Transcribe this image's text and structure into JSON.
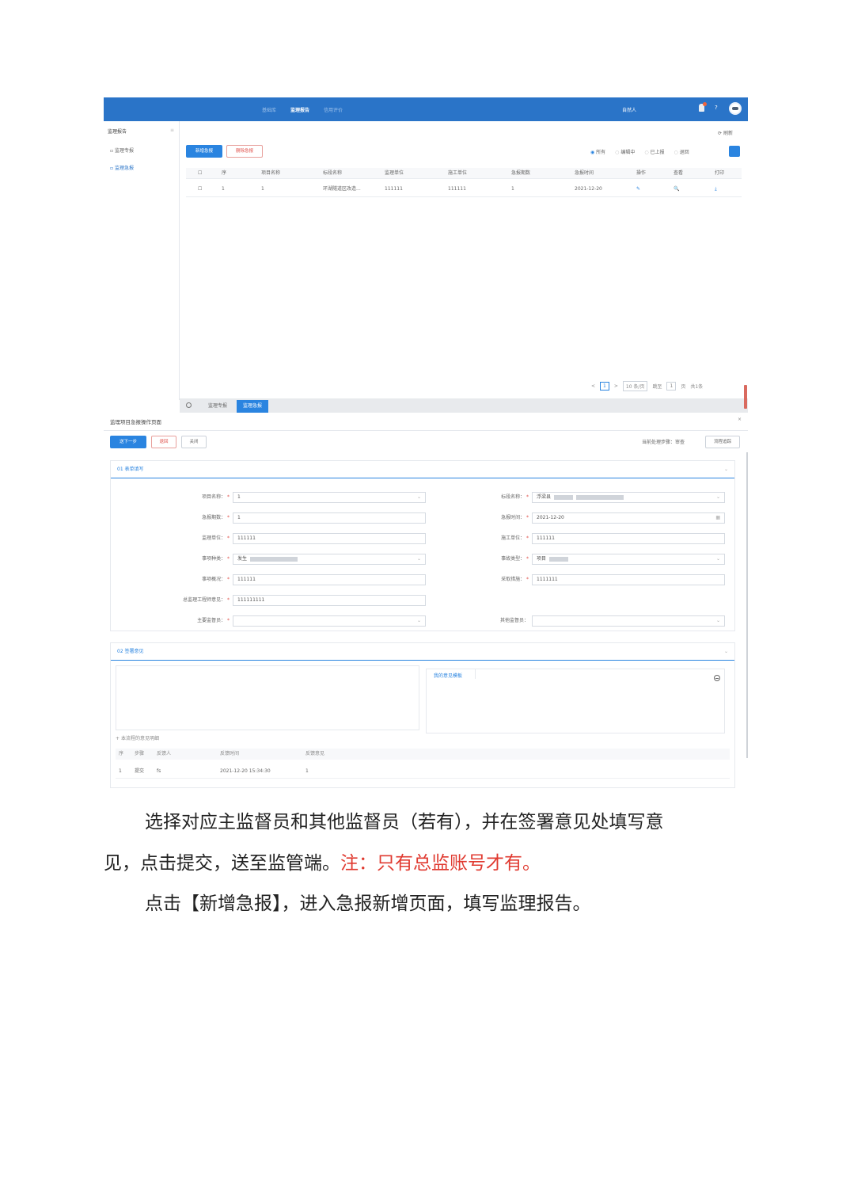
{
  "topbar": {
    "nav": [
      "基础库",
      "监理报告",
      "信用评价"
    ],
    "active_nav": "监理报告",
    "user": "自然人",
    "help": "?"
  },
  "sidebar": {
    "title": "监理报告",
    "collapse": "≡",
    "items": [
      "监理专报",
      "监理急报"
    ],
    "active_item": "监理急报"
  },
  "list": {
    "refresh": "刷新",
    "btn_add": "新增急报",
    "btn_delete": "删除急报",
    "filters": [
      "所有",
      "编辑中",
      "已上报",
      "退回"
    ],
    "filter_active": "所有",
    "columns": [
      "",
      "序",
      "项目名称",
      "标段名称",
      "监理单位",
      "施工单位",
      "急报期数",
      "急报时间",
      "操作",
      "查看",
      "打印"
    ],
    "rows": [
      [
        "",
        "1",
        "1",
        "环湖隧道区改造...",
        "111111",
        "111111",
        "1",
        "2021-12-20",
        "✎",
        "🔍",
        "⤓"
      ]
    ],
    "pager": {
      "prev": "<",
      "page": "1",
      "next": ">",
      "size": "10 条/页",
      "goto": "跳至",
      "goto_value": "1",
      "page_unit": "页",
      "total": "共1条"
    }
  },
  "tabbar": {
    "tabs": [
      "监理专报",
      "监理急报"
    ],
    "active_tab": "监理急报"
  },
  "modal": {
    "title": "监理项目急报操作页面",
    "close": "×",
    "btn_next": "送下一步",
    "btn_back": "退回",
    "btn_close": "关闭",
    "current_step": "当前处理步骤：审查",
    "btn_flow": "流程追踪",
    "sec1_title": "01 表单填写",
    "sec2_title": "02 签署意见",
    "left_fields": [
      {
        "label": "项目名称：",
        "required": true,
        "value": "1",
        "select": true
      },
      {
        "label": "急报期数：",
        "required": true,
        "value": "1",
        "select": false
      },
      {
        "label": "监理单位：",
        "required": true,
        "value": "111111",
        "select": false
      },
      {
        "label": "事项种类：",
        "required": true,
        "value": "发生",
        "select": true
      },
      {
        "label": "事项概况：",
        "required": true,
        "value": "111111",
        "select": false
      },
      {
        "label": "总监理工程师意见：",
        "required": true,
        "value": "111111111",
        "select": false
      },
      {
        "label": "主要监督员：",
        "required": true,
        "value": "",
        "select": true
      }
    ],
    "right_fields": [
      {
        "label": "标段名称：",
        "required": true,
        "value": "浮梁县",
        "select": true
      },
      {
        "label": "急报时间：",
        "required": true,
        "value": "2021-12-20",
        "select": false
      },
      {
        "label": "施工单位：",
        "required": true,
        "value": "111111",
        "select": false
      },
      {
        "label": "事故类型：",
        "required": true,
        "value": "项目",
        "select": true
      },
      {
        "label": "采取措施：",
        "required": true,
        "value": "1111111",
        "select": false
      },
      {
        "label": "其他监督员：",
        "required": false,
        "value": "",
        "select": true
      }
    ],
    "template_label": "我的意见模板",
    "history_label": "本流程的意见明细",
    "history_columns": [
      "序",
      "步骤",
      "反馈人",
      "反馈时间",
      "反馈意见"
    ],
    "history_rows": [
      [
        "1",
        "提交",
        "fs",
        "2021-12-20 15:34:30",
        "1"
      ]
    ]
  },
  "text": {
    "p1_line1": "选择对应主监督员和其他监督员（若有），并在签署意见处填写意",
    "p1_line2": "见，点击提交，送至监管端。",
    "p1_note": "注：只有总监账号才有。",
    "p2": "点击【新增急报】，进入急报新增页面，填写监理报告。"
  }
}
